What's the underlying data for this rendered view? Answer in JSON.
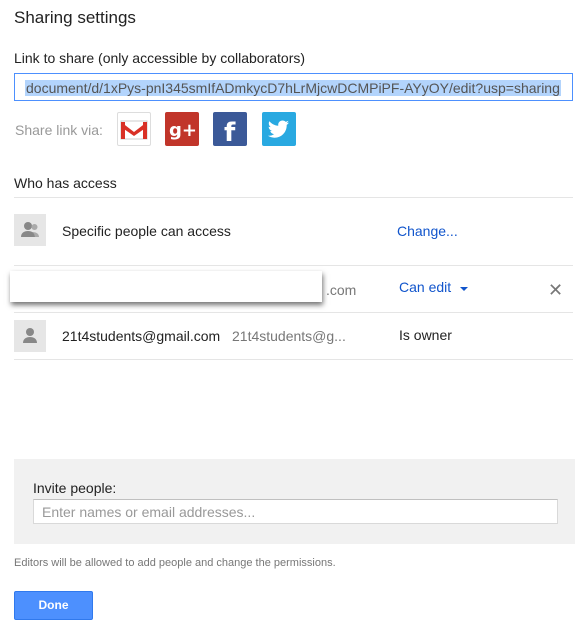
{
  "dialog": {
    "title": "Sharing settings",
    "link_label": "Link to share (only accessible by collaborators)",
    "link_value": "document/d/1xPys-pnI345smIfADmkycD7hLrMjcwDCMPiPF-AYyOY/edit?usp=sharing",
    "share_via_label": "Share link via:",
    "share_icons": [
      "gmail-icon",
      "google-plus-icon",
      "facebook-icon",
      "twitter-icon"
    ]
  },
  "access": {
    "title": "Who has access",
    "general": {
      "label": "Specific people can access",
      "action": "Change..."
    },
    "rows": [
      {
        "email_suffix": ".com",
        "permission": "Can edit",
        "icon": "person-icon"
      },
      {
        "name": "21t4students@gmail.com",
        "email": "21t4students@g...",
        "role": "Is owner",
        "icon": "person-icon"
      }
    ]
  },
  "invite": {
    "label": "Invite people:",
    "placeholder": "Enter names or email addresses..."
  },
  "footer": {
    "note": "Editors will be allowed to add people and change the permissions.",
    "done_label": "Done"
  },
  "colors": {
    "accent": "#4d90fe",
    "link": "#1155cc",
    "gplus": "#c1352a",
    "facebook": "#3b5998",
    "twitter": "#29a9e1"
  }
}
